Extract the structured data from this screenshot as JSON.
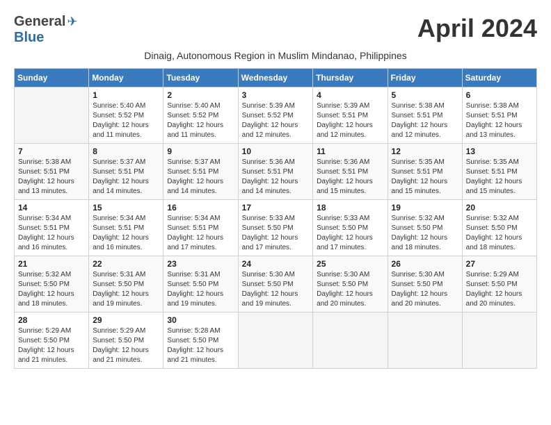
{
  "header": {
    "logo_general": "General",
    "logo_blue": "Blue",
    "month_title": "April 2024",
    "subtitle": "Dinaig, Autonomous Region in Muslim Mindanao, Philippines"
  },
  "days_of_week": [
    "Sunday",
    "Monday",
    "Tuesday",
    "Wednesday",
    "Thursday",
    "Friday",
    "Saturday"
  ],
  "weeks": [
    [
      {
        "day": "",
        "info": ""
      },
      {
        "day": "1",
        "info": "Sunrise: 5:40 AM\nSunset: 5:52 PM\nDaylight: 12 hours\nand 11 minutes."
      },
      {
        "day": "2",
        "info": "Sunrise: 5:40 AM\nSunset: 5:52 PM\nDaylight: 12 hours\nand 11 minutes."
      },
      {
        "day": "3",
        "info": "Sunrise: 5:39 AM\nSunset: 5:52 PM\nDaylight: 12 hours\nand 12 minutes."
      },
      {
        "day": "4",
        "info": "Sunrise: 5:39 AM\nSunset: 5:51 PM\nDaylight: 12 hours\nand 12 minutes."
      },
      {
        "day": "5",
        "info": "Sunrise: 5:38 AM\nSunset: 5:51 PM\nDaylight: 12 hours\nand 12 minutes."
      },
      {
        "day": "6",
        "info": "Sunrise: 5:38 AM\nSunset: 5:51 PM\nDaylight: 12 hours\nand 13 minutes."
      }
    ],
    [
      {
        "day": "7",
        "info": "Sunrise: 5:38 AM\nSunset: 5:51 PM\nDaylight: 12 hours\nand 13 minutes."
      },
      {
        "day": "8",
        "info": "Sunrise: 5:37 AM\nSunset: 5:51 PM\nDaylight: 12 hours\nand 14 minutes."
      },
      {
        "day": "9",
        "info": "Sunrise: 5:37 AM\nSunset: 5:51 PM\nDaylight: 12 hours\nand 14 minutes."
      },
      {
        "day": "10",
        "info": "Sunrise: 5:36 AM\nSunset: 5:51 PM\nDaylight: 12 hours\nand 14 minutes."
      },
      {
        "day": "11",
        "info": "Sunrise: 5:36 AM\nSunset: 5:51 PM\nDaylight: 12 hours\nand 15 minutes."
      },
      {
        "day": "12",
        "info": "Sunrise: 5:35 AM\nSunset: 5:51 PM\nDaylight: 12 hours\nand 15 minutes."
      },
      {
        "day": "13",
        "info": "Sunrise: 5:35 AM\nSunset: 5:51 PM\nDaylight: 12 hours\nand 15 minutes."
      }
    ],
    [
      {
        "day": "14",
        "info": "Sunrise: 5:34 AM\nSunset: 5:51 PM\nDaylight: 12 hours\nand 16 minutes."
      },
      {
        "day": "15",
        "info": "Sunrise: 5:34 AM\nSunset: 5:51 PM\nDaylight: 12 hours\nand 16 minutes."
      },
      {
        "day": "16",
        "info": "Sunrise: 5:34 AM\nSunset: 5:51 PM\nDaylight: 12 hours\nand 17 minutes."
      },
      {
        "day": "17",
        "info": "Sunrise: 5:33 AM\nSunset: 5:50 PM\nDaylight: 12 hours\nand 17 minutes."
      },
      {
        "day": "18",
        "info": "Sunrise: 5:33 AM\nSunset: 5:50 PM\nDaylight: 12 hours\nand 17 minutes."
      },
      {
        "day": "19",
        "info": "Sunrise: 5:32 AM\nSunset: 5:50 PM\nDaylight: 12 hours\nand 18 minutes."
      },
      {
        "day": "20",
        "info": "Sunrise: 5:32 AM\nSunset: 5:50 PM\nDaylight: 12 hours\nand 18 minutes."
      }
    ],
    [
      {
        "day": "21",
        "info": "Sunrise: 5:32 AM\nSunset: 5:50 PM\nDaylight: 12 hours\nand 18 minutes."
      },
      {
        "day": "22",
        "info": "Sunrise: 5:31 AM\nSunset: 5:50 PM\nDaylight: 12 hours\nand 19 minutes."
      },
      {
        "day": "23",
        "info": "Sunrise: 5:31 AM\nSunset: 5:50 PM\nDaylight: 12 hours\nand 19 minutes."
      },
      {
        "day": "24",
        "info": "Sunrise: 5:30 AM\nSunset: 5:50 PM\nDaylight: 12 hours\nand 19 minutes."
      },
      {
        "day": "25",
        "info": "Sunrise: 5:30 AM\nSunset: 5:50 PM\nDaylight: 12 hours\nand 20 minutes."
      },
      {
        "day": "26",
        "info": "Sunrise: 5:30 AM\nSunset: 5:50 PM\nDaylight: 12 hours\nand 20 minutes."
      },
      {
        "day": "27",
        "info": "Sunrise: 5:29 AM\nSunset: 5:50 PM\nDaylight: 12 hours\nand 20 minutes."
      }
    ],
    [
      {
        "day": "28",
        "info": "Sunrise: 5:29 AM\nSunset: 5:50 PM\nDaylight: 12 hours\nand 21 minutes."
      },
      {
        "day": "29",
        "info": "Sunrise: 5:29 AM\nSunset: 5:50 PM\nDaylight: 12 hours\nand 21 minutes."
      },
      {
        "day": "30",
        "info": "Sunrise: 5:28 AM\nSunset: 5:50 PM\nDaylight: 12 hours\nand 21 minutes."
      },
      {
        "day": "",
        "info": ""
      },
      {
        "day": "",
        "info": ""
      },
      {
        "day": "",
        "info": ""
      },
      {
        "day": "",
        "info": ""
      }
    ]
  ]
}
